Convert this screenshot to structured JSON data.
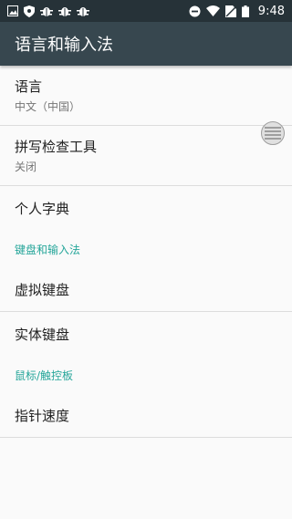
{
  "status_bar": {
    "time": "9:48",
    "icons_left": [
      "image-icon",
      "shield-icon",
      "bug-icon",
      "bug-icon",
      "bug-icon"
    ],
    "icons_right": [
      "do-not-disturb-icon",
      "wifi-icon",
      "no-sim-icon",
      "battery-icon"
    ]
  },
  "app_bar": {
    "title": "语言和输入法"
  },
  "items": {
    "language": {
      "title": "语言",
      "summary": "中文（中国）"
    },
    "spellcheck": {
      "title": "拼写检查工具",
      "summary": "关闭"
    },
    "dictionary": {
      "title": "个人字典"
    },
    "cat_keyboard": {
      "label": "键盘和输入法"
    },
    "virtual_keyboard": {
      "title": "虚拟键盘"
    },
    "physical_keyboard": {
      "title": "实体键盘"
    },
    "cat_mouse": {
      "label": "鼠标/触控板"
    },
    "pointer_speed": {
      "title": "指针速度"
    }
  },
  "colors": {
    "statusbar": "#263238",
    "appbar": "#37474f",
    "accent": "#26a69a"
  }
}
